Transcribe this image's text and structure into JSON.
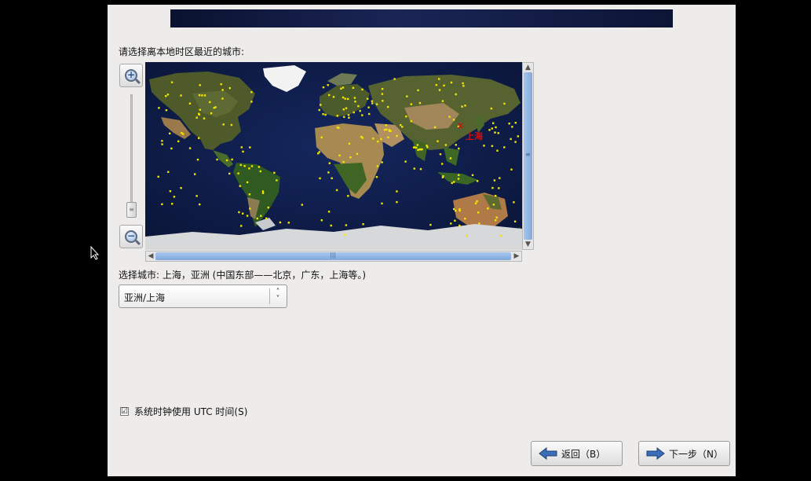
{
  "prompt": "请选择离本地时区最近的城市:",
  "map": {
    "city_label": "上海",
    "marker": "x"
  },
  "zoom": {
    "in_icon": "zoom-in-icon",
    "out_icon": "zoom-out-icon"
  },
  "selected_city_text": "选择城市: 上海，亚洲 (中国东部——北京，广东，上海等。)",
  "timezone_select": {
    "value": "亚洲/上海"
  },
  "utc_checkbox": {
    "label": "系统时钟使用 UTC 时间(S)",
    "checked": true,
    "mark": "☑"
  },
  "buttons": {
    "back": "返回（B）",
    "next": "下一步（N）"
  },
  "colors": {
    "ocean": "#0d1a44",
    "city_dot": "#f2e600",
    "selected_marker": "#d01010",
    "scroll_thumb": "#8fb5e4"
  }
}
